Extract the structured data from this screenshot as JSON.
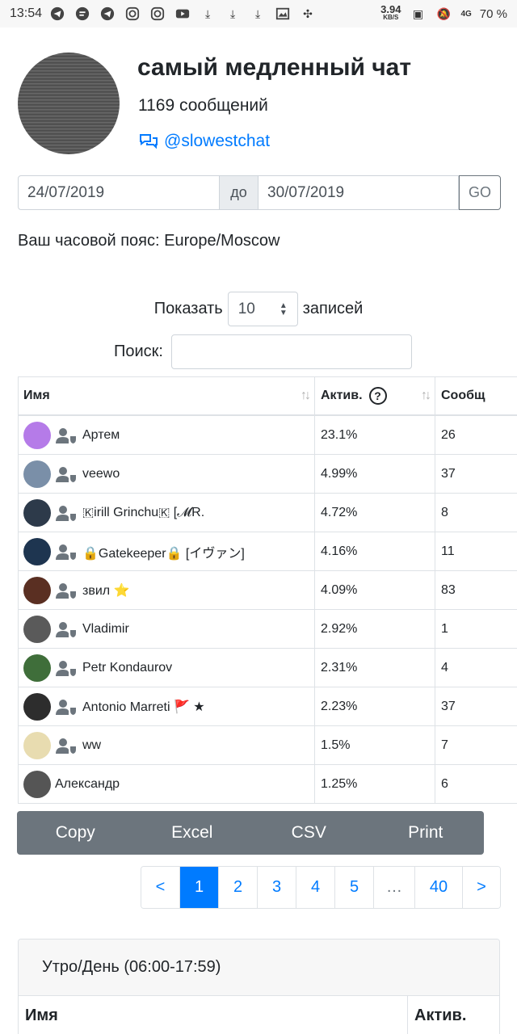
{
  "status_bar": {
    "time": "13:54",
    "net_speed": "3.94",
    "net_unit": "KB/S",
    "network": "4G",
    "battery": "70 %"
  },
  "chat": {
    "title": "самый медленный чат",
    "message_count": "1169 сообщений",
    "handle": "@slowestchat"
  },
  "date_range": {
    "from": "24/07/2019",
    "separator": "до",
    "to": "30/07/2019",
    "go_label": "GO"
  },
  "timezone": "Ваш часовой пояс: Europe/Moscow",
  "controls": {
    "show_label": "Показать",
    "show_value": "10",
    "records_label": "записей",
    "search_label": "Поиск:"
  },
  "table": {
    "headers": [
      "Имя",
      "Актив.",
      "Сообщ"
    ],
    "rows": [
      {
        "name": "Артем",
        "activity": "23.1%",
        "messages": "26",
        "avatar_color": "#b57be8",
        "admin": true
      },
      {
        "name": "veewo",
        "activity": "4.99%",
        "messages": "37",
        "avatar_color": "#7a8fa8",
        "admin": true
      },
      {
        "name": "🇰irill Grinchu🇰 [𝓜R.",
        "activity": "4.72%",
        "messages": "8",
        "avatar_color": "#2d3a4a",
        "admin": true
      },
      {
        "name": "🔒Gatekeeper🔒 [イヴァン]",
        "activity": "4.16%",
        "messages": "11",
        "avatar_color": "#1e3550",
        "admin": true
      },
      {
        "name": "звил ⭐",
        "activity": "4.09%",
        "messages": "83",
        "avatar_color": "#5a2f22",
        "admin": true
      },
      {
        "name": "Vladimir",
        "activity": "2.92%",
        "messages": "1",
        "avatar_color": "#5a5a5a",
        "admin": true
      },
      {
        "name": "Petr Kondaurov",
        "activity": "2.31%",
        "messages": "4",
        "avatar_color": "#3f6e3a",
        "admin": true
      },
      {
        "name": "Antonio Marreti 🚩 ★",
        "activity": "2.23%",
        "messages": "37",
        "avatar_color": "#2d2d2d",
        "admin": true
      },
      {
        "name": "ww",
        "activity": "1.5%",
        "messages": "7",
        "avatar_color": "#e8dcb0",
        "admin": true
      },
      {
        "name": "Александр",
        "activity": "1.25%",
        "messages": "6",
        "avatar_color": "#555555",
        "admin": false
      }
    ]
  },
  "export_buttons": [
    "Copy",
    "Excel",
    "CSV",
    "Print"
  ],
  "pagination": {
    "prev": "<",
    "pages": [
      "1",
      "2",
      "3",
      "4",
      "5",
      "…",
      "40"
    ],
    "next": ">",
    "active": "1"
  },
  "section": {
    "title": "Утро/День (06:00-17:59)",
    "headers": [
      "Имя",
      "Актив."
    ]
  },
  "colors": {
    "link": "#007bff",
    "secondary": "#6c757d"
  }
}
